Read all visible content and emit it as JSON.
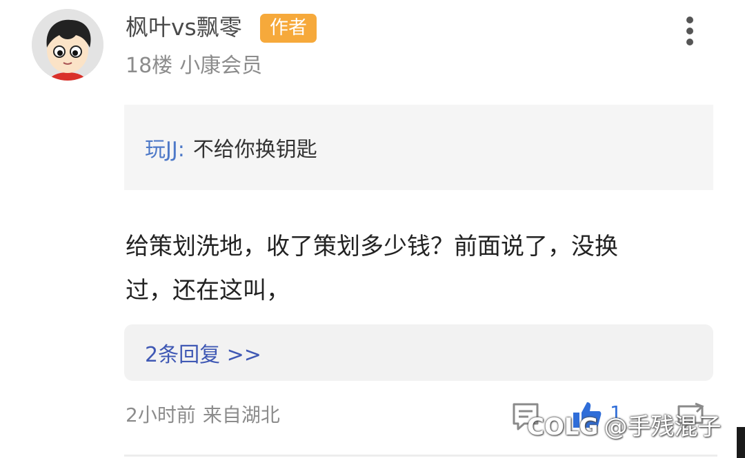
{
  "post": {
    "username": "枫叶vs飘零",
    "author_badge": "作者",
    "floor": "18楼",
    "member_level": "小康会员",
    "quote": {
      "author": "玩JJ:",
      "text": "不给你换钥匙"
    },
    "body_lines": [
      "给策划洗地，收了策划多少钱？前面说了，没换",
      "过，还在这叫，"
    ],
    "replies_link": "2条回复 >>",
    "time": "2小时前",
    "location": "来自湖北",
    "like_count": "1"
  },
  "icons": {
    "more": "more-vertical-icon",
    "comment": "comment-icon",
    "like": "thumbs-up-icon",
    "share": "share-icon"
  },
  "colors": {
    "badge": "#f6a93b",
    "link": "#3f58b4",
    "quote_author": "#4e79c8",
    "like": "#2f6dd8"
  },
  "watermark": {
    "brand": "COLG",
    "handle": "@手残混子"
  }
}
